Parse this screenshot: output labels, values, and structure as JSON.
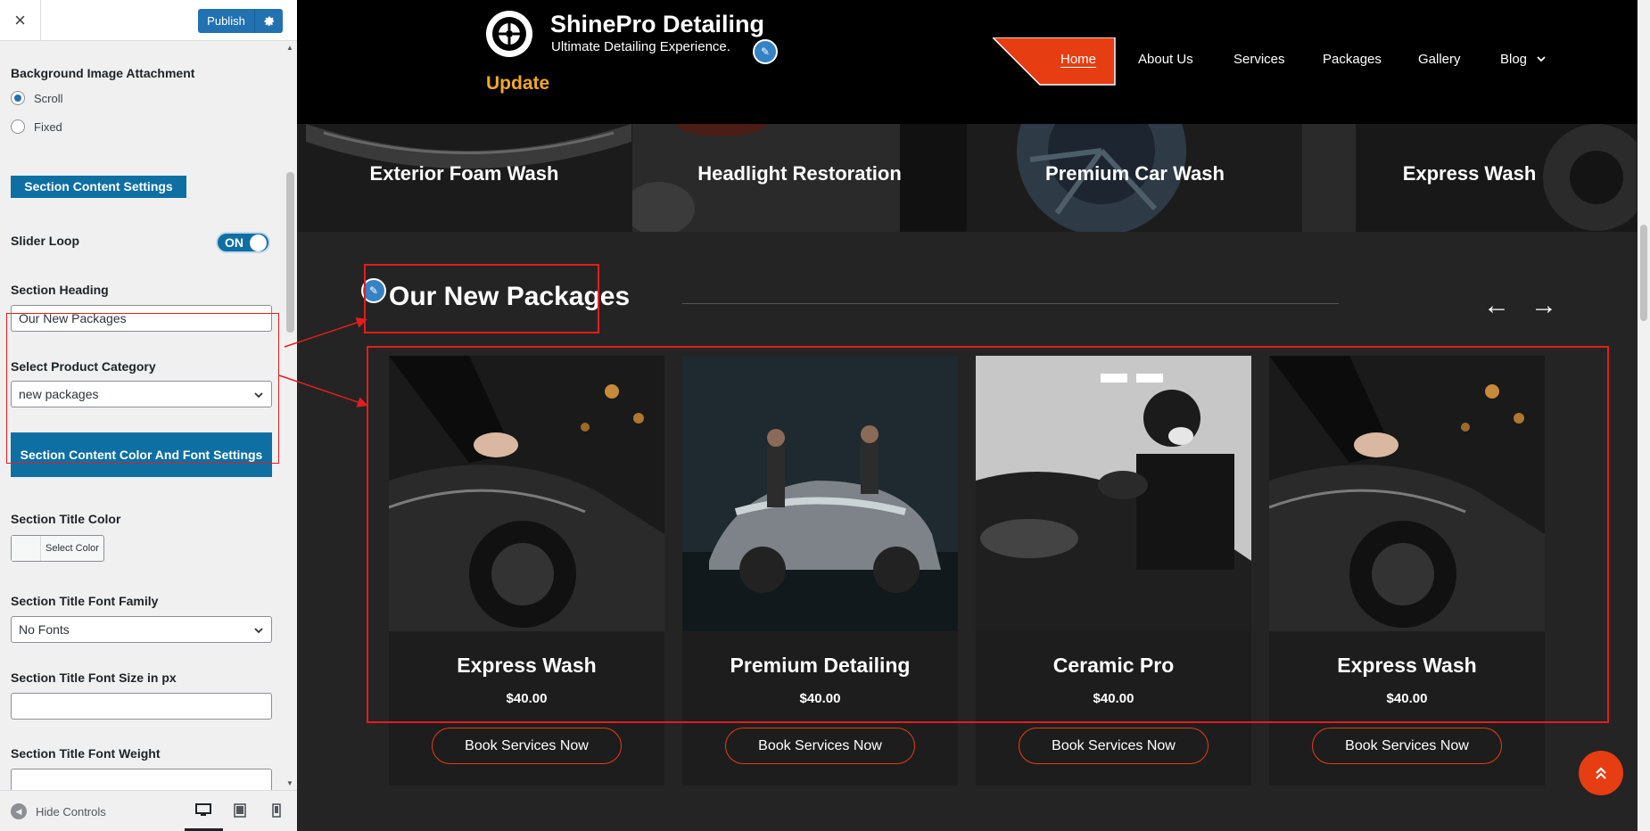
{
  "customizer": {
    "close_icon": "×",
    "publish_label": "Publish",
    "settings_icon": "gear-icon",
    "sections": {
      "bg_attachment_label": "Background Image Attachment",
      "bg_attachment_options": [
        "Scroll",
        "Fixed"
      ],
      "bg_attachment_selected": "Scroll",
      "content_settings_button": "Section Content Settings",
      "slider_loop_label": "Slider Loop",
      "slider_loop_state": "ON",
      "section_heading_label": "Section Heading",
      "section_heading_value": "Our New Packages",
      "product_category_label": "Select Product Category",
      "product_category_value": "new packages",
      "color_font_button": "Section Content Color And Font Settings",
      "title_color_label": "Section Title Color",
      "select_color_label": "Select Color",
      "title_font_family_label": "Section Title Font Family",
      "title_font_family_value": "No Fonts",
      "title_font_size_label": "Section Title Font Size in px",
      "title_font_size_value": "",
      "title_font_weight_label": "Section Title Font Weight",
      "title_font_weight_value": ""
    },
    "footer": {
      "hide_controls": "Hide Controls",
      "devices": [
        "desktop",
        "tablet",
        "mobile"
      ],
      "active_device": "desktop"
    }
  },
  "site": {
    "logo": {
      "name": "ShinePro Detailing",
      "tagline": "Ultimate Detailing Experience."
    },
    "update_label": "Update",
    "nav": {
      "items": [
        "Home",
        "About Us",
        "Services",
        "Packages",
        "Gallery",
        "Blog"
      ],
      "active": "Home",
      "dropdown_icon": "chevron-down-icon"
    },
    "services_strip": [
      "Exterior Foam Wash",
      "Headlight Restoration",
      "Premium Car Wash",
      "Express Wash"
    ],
    "packages_section": {
      "heading": "Our New Packages",
      "prev_arrow": "←",
      "next_arrow": "→",
      "cards": [
        {
          "title": "Express Wash",
          "price": "$40.00",
          "button": "Book Services Now"
        },
        {
          "title": "Premium Detailing",
          "price": "$40.00",
          "button": "Book Services Now"
        },
        {
          "title": "Ceramic Pro",
          "price": "$40.00",
          "button": "Book Services Now"
        },
        {
          "title": "Express Wash",
          "price": "$40.00",
          "button": "Book Services Now"
        }
      ]
    },
    "back_to_top_icon": "double-chevron-up-icon"
  },
  "colors": {
    "accent_orange": "#e63d12",
    "update_yellow": "#f2a921",
    "customizer_blue": "#2271b1",
    "section_button_blue": "#0e6fa3",
    "annotation_red": "#e21d1d"
  }
}
